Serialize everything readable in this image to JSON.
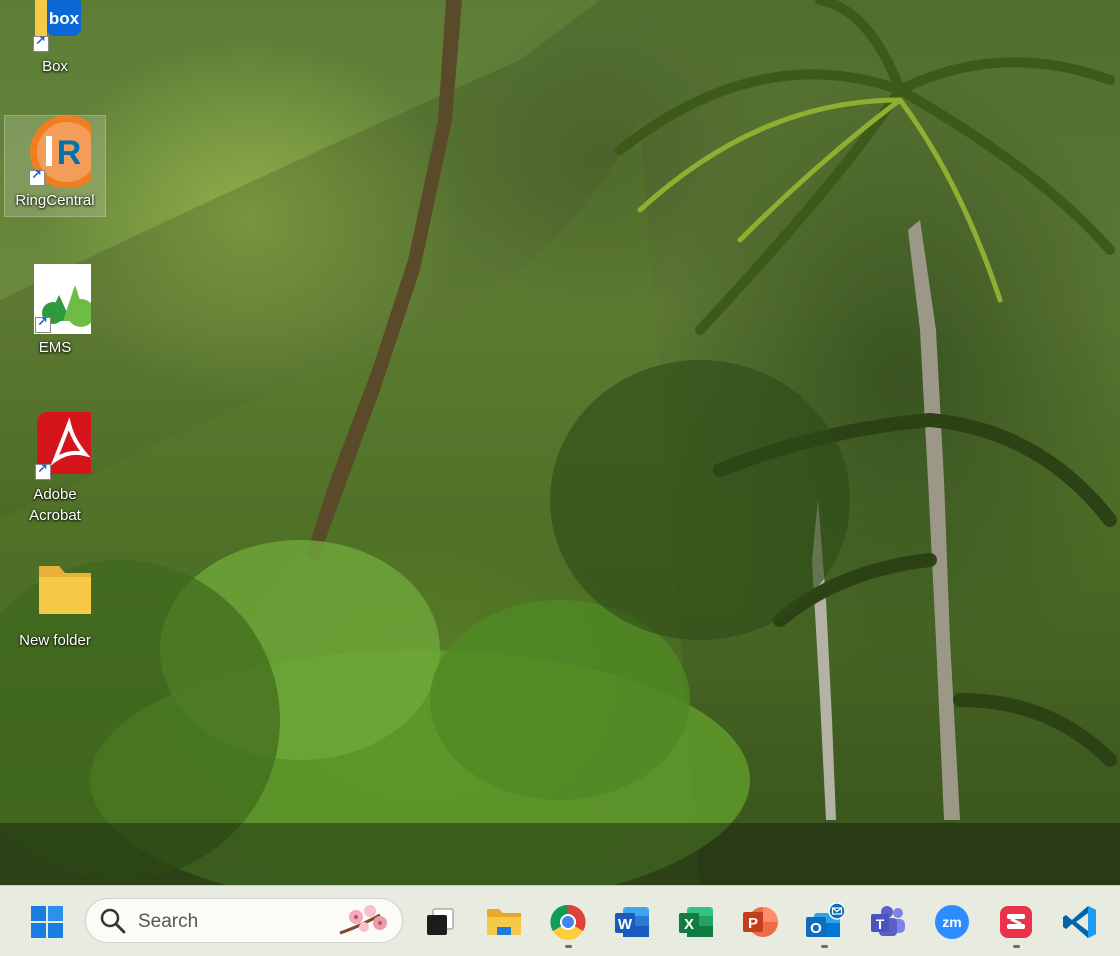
{
  "desktop": {
    "icons": [
      {
        "label": "Box"
      },
      {
        "label": "RingCentral"
      },
      {
        "label": "EMS"
      },
      {
        "label": "Adobe Acrobat",
        "line1": "Adobe",
        "line2": "Acrobat"
      },
      {
        "label": "New folder"
      }
    ],
    "box_badge_text": "box",
    "ringcentral_mark": "R"
  },
  "taskbar": {
    "search_placeholder": "Search",
    "apps": [
      {
        "icon": "windows-start-icon"
      },
      {
        "icon": "task-view-icon"
      },
      {
        "icon": "file-explorer-icon"
      },
      {
        "icon": "chrome-icon",
        "running": true
      },
      {
        "icon": "word-icon",
        "letter": "W"
      },
      {
        "icon": "excel-icon",
        "letter": "X"
      },
      {
        "icon": "powerpoint-icon",
        "letter": "P"
      },
      {
        "icon": "outlook-icon",
        "letter": "O",
        "running": true
      },
      {
        "icon": "teams-icon",
        "letter": "T"
      },
      {
        "icon": "zoom-icon",
        "letter": "zm"
      },
      {
        "icon": "ringcentral-taskbar-icon",
        "running": true
      },
      {
        "icon": "vscode-icon"
      }
    ]
  },
  "colors": {
    "word": "#185abd",
    "excel": "#107c41",
    "powerpoint": "#c43e1c",
    "outlook": "#0f6cbd",
    "teams": "#5b5fc7",
    "zoom": "#2d8cff",
    "acrobat": "#d4151b",
    "folder": "#f7c948"
  }
}
